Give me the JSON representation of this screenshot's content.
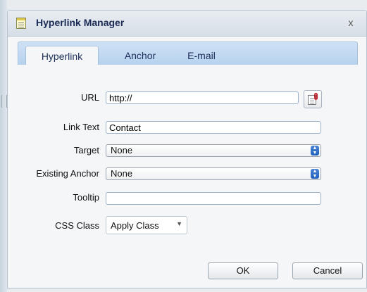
{
  "dialog": {
    "title": "Hyperlink Manager",
    "close_label": "x"
  },
  "tabs": [
    {
      "label": "Hyperlink",
      "active": true
    },
    {
      "label": "Anchor",
      "active": false
    },
    {
      "label": "E-mail",
      "active": false
    }
  ],
  "form": {
    "url": {
      "label": "URL",
      "value": "http://"
    },
    "link_text": {
      "label": "Link Text",
      "value": "Contact"
    },
    "target": {
      "label": "Target",
      "selected": "None"
    },
    "existing_anchor": {
      "label": "Existing Anchor",
      "selected": "None"
    },
    "tooltip": {
      "label": "Tooltip",
      "value": ""
    },
    "css_class": {
      "label": "CSS Class",
      "selected": "Apply Class"
    }
  },
  "buttons": {
    "ok": "OK",
    "cancel": "Cancel"
  },
  "icons": {
    "title": "document-icon",
    "link_picker": "document-link-icon"
  }
}
